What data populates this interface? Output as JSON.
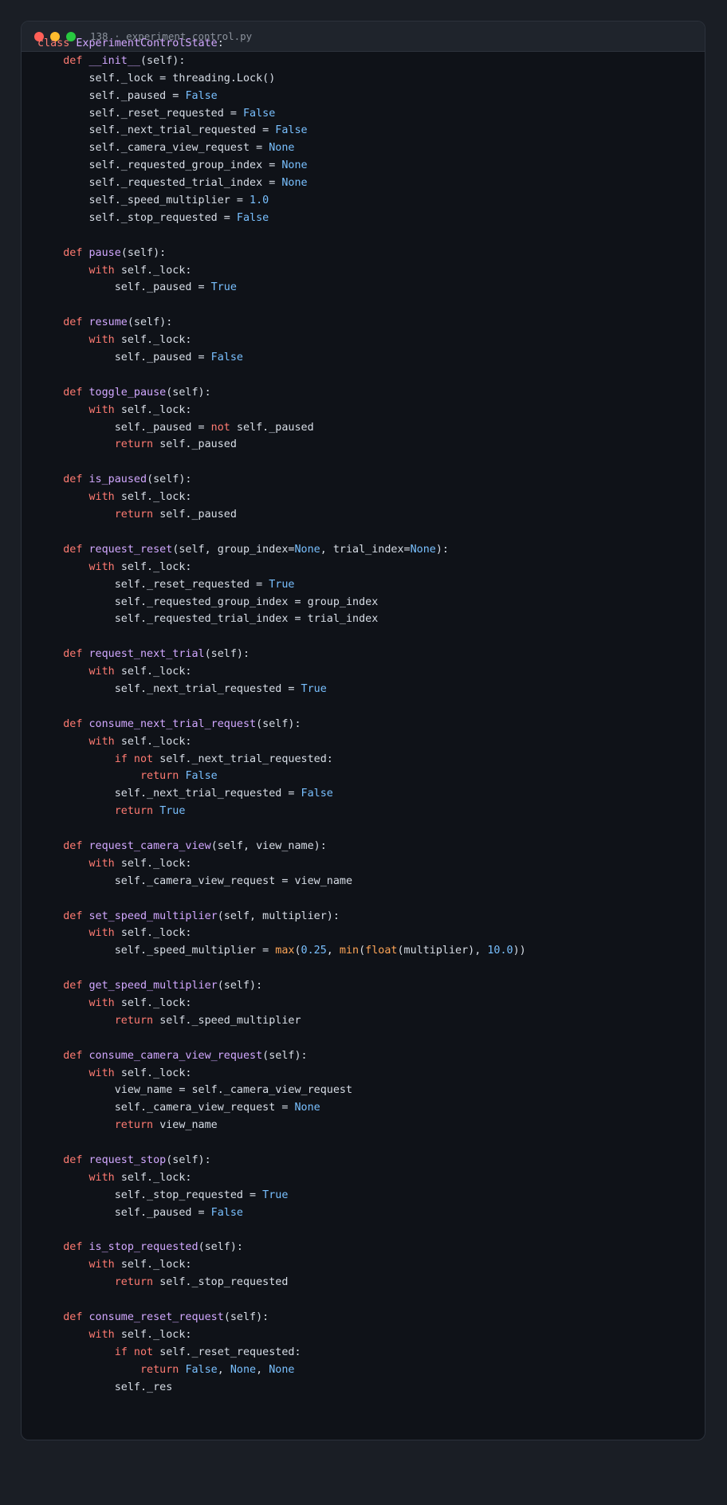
{
  "window": {
    "title": "138 · experiment_control.py"
  },
  "colors": {
    "background": "#1a1e25",
    "editor": "#0f1218",
    "keyword": "#ff7b72",
    "function": "#d2a8ff",
    "constant": "#79c0ff",
    "builtin": "#ffa657",
    "text": "#d8dee7"
  },
  "code": [
    [
      [
        "kw",
        "class "
      ],
      [
        "cls",
        "ExperimentControlState"
      ],
      [
        "t",
        ":"
      ]
    ],
    [
      [
        "t",
        "    "
      ],
      [
        "kw",
        "def "
      ],
      [
        "fn",
        "__init__"
      ],
      [
        "t",
        "(self):"
      ]
    ],
    [
      [
        "t",
        "        self._lock = threading.Lock()"
      ]
    ],
    [
      [
        "t",
        "        self._paused = "
      ],
      [
        "c",
        "False"
      ]
    ],
    [
      [
        "t",
        "        self._reset_requested = "
      ],
      [
        "c",
        "False"
      ]
    ],
    [
      [
        "t",
        "        self._next_trial_requested = "
      ],
      [
        "c",
        "False"
      ]
    ],
    [
      [
        "t",
        "        self._camera_view_request = "
      ],
      [
        "c",
        "None"
      ]
    ],
    [
      [
        "t",
        "        self._requested_group_index = "
      ],
      [
        "c",
        "None"
      ]
    ],
    [
      [
        "t",
        "        self._requested_trial_index = "
      ],
      [
        "c",
        "None"
      ]
    ],
    [
      [
        "t",
        "        self._speed_multiplier = "
      ],
      [
        "n",
        "1.0"
      ]
    ],
    [
      [
        "t",
        "        self._stop_requested = "
      ],
      [
        "c",
        "False"
      ]
    ],
    [],
    [
      [
        "t",
        "    "
      ],
      [
        "kw",
        "def "
      ],
      [
        "fn",
        "pause"
      ],
      [
        "t",
        "(self):"
      ]
    ],
    [
      [
        "t",
        "        "
      ],
      [
        "kw",
        "with "
      ],
      [
        "t",
        "self._lock:"
      ]
    ],
    [
      [
        "t",
        "            self._paused = "
      ],
      [
        "c",
        "True"
      ]
    ],
    [],
    [
      [
        "t",
        "    "
      ],
      [
        "kw",
        "def "
      ],
      [
        "fn",
        "resume"
      ],
      [
        "t",
        "(self):"
      ]
    ],
    [
      [
        "t",
        "        "
      ],
      [
        "kw",
        "with "
      ],
      [
        "t",
        "self._lock:"
      ]
    ],
    [
      [
        "t",
        "            self._paused = "
      ],
      [
        "c",
        "False"
      ]
    ],
    [],
    [
      [
        "t",
        "    "
      ],
      [
        "kw",
        "def "
      ],
      [
        "fn",
        "toggle_pause"
      ],
      [
        "t",
        "(self):"
      ]
    ],
    [
      [
        "t",
        "        "
      ],
      [
        "kw",
        "with "
      ],
      [
        "t",
        "self._lock:"
      ]
    ],
    [
      [
        "t",
        "            self._paused = "
      ],
      [
        "kw",
        "not "
      ],
      [
        "t",
        "self._paused"
      ]
    ],
    [
      [
        "t",
        "            "
      ],
      [
        "kw",
        "return "
      ],
      [
        "t",
        "self._paused"
      ]
    ],
    [],
    [
      [
        "t",
        "    "
      ],
      [
        "kw",
        "def "
      ],
      [
        "fn",
        "is_paused"
      ],
      [
        "t",
        "(self):"
      ]
    ],
    [
      [
        "t",
        "        "
      ],
      [
        "kw",
        "with "
      ],
      [
        "t",
        "self._lock:"
      ]
    ],
    [
      [
        "t",
        "            "
      ],
      [
        "kw",
        "return "
      ],
      [
        "t",
        "self._paused"
      ]
    ],
    [],
    [
      [
        "t",
        "    "
      ],
      [
        "kw",
        "def "
      ],
      [
        "fn",
        "request_reset"
      ],
      [
        "t",
        "(self, group_index="
      ],
      [
        "c",
        "None"
      ],
      [
        "t",
        ", trial_index="
      ],
      [
        "c",
        "None"
      ],
      [
        "t",
        "):"
      ]
    ],
    [
      [
        "t",
        "        "
      ],
      [
        "kw",
        "with "
      ],
      [
        "t",
        "self._lock:"
      ]
    ],
    [
      [
        "t",
        "            self._reset_requested = "
      ],
      [
        "c",
        "True"
      ]
    ],
    [
      [
        "t",
        "            self._requested_group_index = group_index"
      ]
    ],
    [
      [
        "t",
        "            self._requested_trial_index = trial_index"
      ]
    ],
    [],
    [
      [
        "t",
        "    "
      ],
      [
        "kw",
        "def "
      ],
      [
        "fn",
        "request_next_trial"
      ],
      [
        "t",
        "(self):"
      ]
    ],
    [
      [
        "t",
        "        "
      ],
      [
        "kw",
        "with "
      ],
      [
        "t",
        "self._lock:"
      ]
    ],
    [
      [
        "t",
        "            self._next_trial_requested = "
      ],
      [
        "c",
        "True"
      ]
    ],
    [],
    [
      [
        "t",
        "    "
      ],
      [
        "kw",
        "def "
      ],
      [
        "fn",
        "consume_next_trial_request"
      ],
      [
        "t",
        "(self):"
      ]
    ],
    [
      [
        "t",
        "        "
      ],
      [
        "kw",
        "with "
      ],
      [
        "t",
        "self._lock:"
      ]
    ],
    [
      [
        "t",
        "            "
      ],
      [
        "kw",
        "if not "
      ],
      [
        "t",
        "self._next_trial_requested:"
      ]
    ],
    [
      [
        "t",
        "                "
      ],
      [
        "kw",
        "return "
      ],
      [
        "c",
        "False"
      ]
    ],
    [
      [
        "t",
        "            self._next_trial_requested = "
      ],
      [
        "c",
        "False"
      ]
    ],
    [
      [
        "t",
        "            "
      ],
      [
        "kw",
        "return "
      ],
      [
        "c",
        "True"
      ]
    ],
    [],
    [
      [
        "t",
        "    "
      ],
      [
        "kw",
        "def "
      ],
      [
        "fn",
        "request_camera_view"
      ],
      [
        "t",
        "(self, view_name):"
      ]
    ],
    [
      [
        "t",
        "        "
      ],
      [
        "kw",
        "with "
      ],
      [
        "t",
        "self._lock:"
      ]
    ],
    [
      [
        "t",
        "            self._camera_view_request = view_name"
      ]
    ],
    [],
    [
      [
        "t",
        "    "
      ],
      [
        "kw",
        "def "
      ],
      [
        "fn",
        "set_speed_multiplier"
      ],
      [
        "t",
        "(self, multiplier):"
      ]
    ],
    [
      [
        "t",
        "        "
      ],
      [
        "kw",
        "with "
      ],
      [
        "t",
        "self._lock:"
      ]
    ],
    [
      [
        "t",
        "            self._speed_multiplier = "
      ],
      [
        "b",
        "max"
      ],
      [
        "t",
        "("
      ],
      [
        "n",
        "0.25"
      ],
      [
        "t",
        ", "
      ],
      [
        "b",
        "min"
      ],
      [
        "t",
        "("
      ],
      [
        "b",
        "float"
      ],
      [
        "t",
        "(multiplier), "
      ],
      [
        "n",
        "10.0"
      ],
      [
        "t",
        "))"
      ]
    ],
    [],
    [
      [
        "t",
        "    "
      ],
      [
        "kw",
        "def "
      ],
      [
        "fn",
        "get_speed_multiplier"
      ],
      [
        "t",
        "(self):"
      ]
    ],
    [
      [
        "t",
        "        "
      ],
      [
        "kw",
        "with "
      ],
      [
        "t",
        "self._lock:"
      ]
    ],
    [
      [
        "t",
        "            "
      ],
      [
        "kw",
        "return "
      ],
      [
        "t",
        "self._speed_multiplier"
      ]
    ],
    [],
    [
      [
        "t",
        "    "
      ],
      [
        "kw",
        "def "
      ],
      [
        "fn",
        "consume_camera_view_request"
      ],
      [
        "t",
        "(self):"
      ]
    ],
    [
      [
        "t",
        "        "
      ],
      [
        "kw",
        "with "
      ],
      [
        "t",
        "self._lock:"
      ]
    ],
    [
      [
        "t",
        "            view_name = self._camera_view_request"
      ]
    ],
    [
      [
        "t",
        "            self._camera_view_request = "
      ],
      [
        "c",
        "None"
      ]
    ],
    [
      [
        "t",
        "            "
      ],
      [
        "kw",
        "return "
      ],
      [
        "t",
        "view_name"
      ]
    ],
    [],
    [
      [
        "t",
        "    "
      ],
      [
        "kw",
        "def "
      ],
      [
        "fn",
        "request_stop"
      ],
      [
        "t",
        "(self):"
      ]
    ],
    [
      [
        "t",
        "        "
      ],
      [
        "kw",
        "with "
      ],
      [
        "t",
        "self._lock:"
      ]
    ],
    [
      [
        "t",
        "            self._stop_requested = "
      ],
      [
        "c",
        "True"
      ]
    ],
    [
      [
        "t",
        "            self._paused = "
      ],
      [
        "c",
        "False"
      ]
    ],
    [],
    [
      [
        "t",
        "    "
      ],
      [
        "kw",
        "def "
      ],
      [
        "fn",
        "is_stop_requested"
      ],
      [
        "t",
        "(self):"
      ]
    ],
    [
      [
        "t",
        "        "
      ],
      [
        "kw",
        "with "
      ],
      [
        "t",
        "self._lock:"
      ]
    ],
    [
      [
        "t",
        "            "
      ],
      [
        "kw",
        "return "
      ],
      [
        "t",
        "self._stop_requested"
      ]
    ],
    [],
    [
      [
        "t",
        "    "
      ],
      [
        "kw",
        "def "
      ],
      [
        "fn",
        "consume_reset_request"
      ],
      [
        "t",
        "(self):"
      ]
    ],
    [
      [
        "t",
        "        "
      ],
      [
        "kw",
        "with "
      ],
      [
        "t",
        "self._lock:"
      ]
    ],
    [
      [
        "t",
        "            "
      ],
      [
        "kw",
        "if not "
      ],
      [
        "t",
        "self._reset_requested:"
      ]
    ],
    [
      [
        "t",
        "                "
      ],
      [
        "kw",
        "return "
      ],
      [
        "c",
        "False"
      ],
      [
        "t",
        ", "
      ],
      [
        "c",
        "None"
      ],
      [
        "t",
        ", "
      ],
      [
        "c",
        "None"
      ]
    ],
    [
      [
        "t",
        "            self._res"
      ]
    ]
  ]
}
